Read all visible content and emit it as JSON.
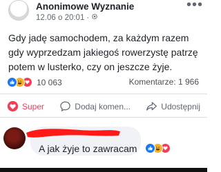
{
  "post": {
    "author": "Anonimowe Wyznanie",
    "timestamp": "12.06 o 20:01",
    "separator": "·",
    "privacy_icon": "gear-icon",
    "more_icon": "more-options-icon",
    "text": "Gdy jadę samochodem, za każdym razem gdy wyprzedzam jakiegoś rowerzystę patrzę potem w lusterko, czy on jeszcze żyje."
  },
  "stats": {
    "reaction_icons": [
      "like-icon",
      "haha-icon",
      "love-icon"
    ],
    "reactions_count": "10 063",
    "comments_count": "Komentarze: 1 966"
  },
  "actions": {
    "react_label": "Super",
    "comment_label": "Dodaj komen...",
    "share_label": "Udostępnij"
  },
  "comment": {
    "text": "A jak żyje to zawracam",
    "reaction_icons": [
      "like-icon",
      "haha-icon",
      "love-icon"
    ]
  },
  "colors": {
    "like_blue": "#1877f2",
    "haha_yellow": "#f7b125",
    "love_red": "#f33e58",
    "scribble_red": "#ff1a1a",
    "text_dark": "#1d2129",
    "text_gray": "#606770"
  }
}
